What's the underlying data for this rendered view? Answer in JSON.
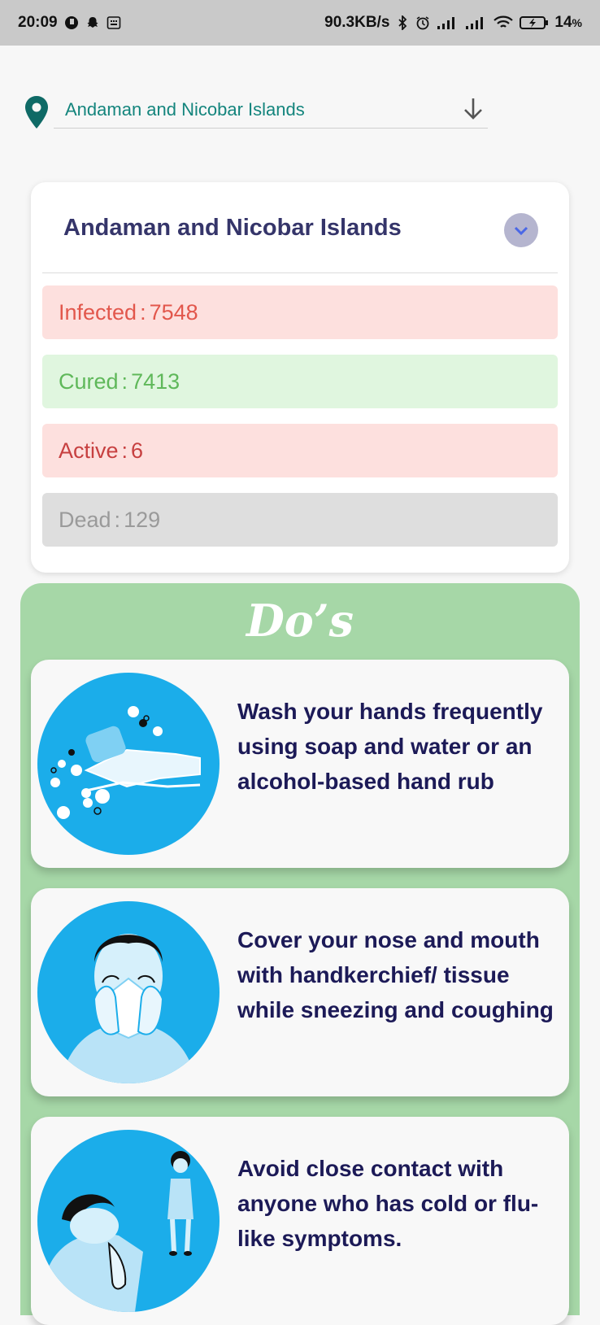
{
  "status_bar": {
    "time": "20:09",
    "net_speed": "90.3KB/s",
    "battery": "14",
    "battery_unit": "%"
  },
  "location": {
    "selected": "Andaman and Nicobar Islands",
    "icon": "location-pin-icon",
    "accent": "#14857d"
  },
  "state_card": {
    "title": "Andaman and Nicobar Islands",
    "stats": {
      "infected": {
        "label": "Infected",
        "value": "7548",
        "color": "#e2574c"
      },
      "cured": {
        "label": "Cured",
        "value": "7413",
        "color": "#5fb85a"
      },
      "active": {
        "label": "Active",
        "value": "6",
        "color": "#c74040"
      },
      "dead": {
        "label": "Dead",
        "value": "129",
        "color": "#9a9a9a"
      }
    }
  },
  "dos": {
    "title": "Do’s",
    "background": "#a6d7a7",
    "items": [
      {
        "text": "Wash your hands frequently using soap and water or an alcohol-based hand rub",
        "icon": "handwashing-icon"
      },
      {
        "text": "Cover your nose and mouth with handkerchief/ tissue while sneezing and coughing",
        "icon": "sneeze-cover-icon"
      },
      {
        "text": "Avoid close contact with anyone who has cold or flu-like symptoms.",
        "icon": "distance-sick-person-icon"
      }
    ]
  }
}
